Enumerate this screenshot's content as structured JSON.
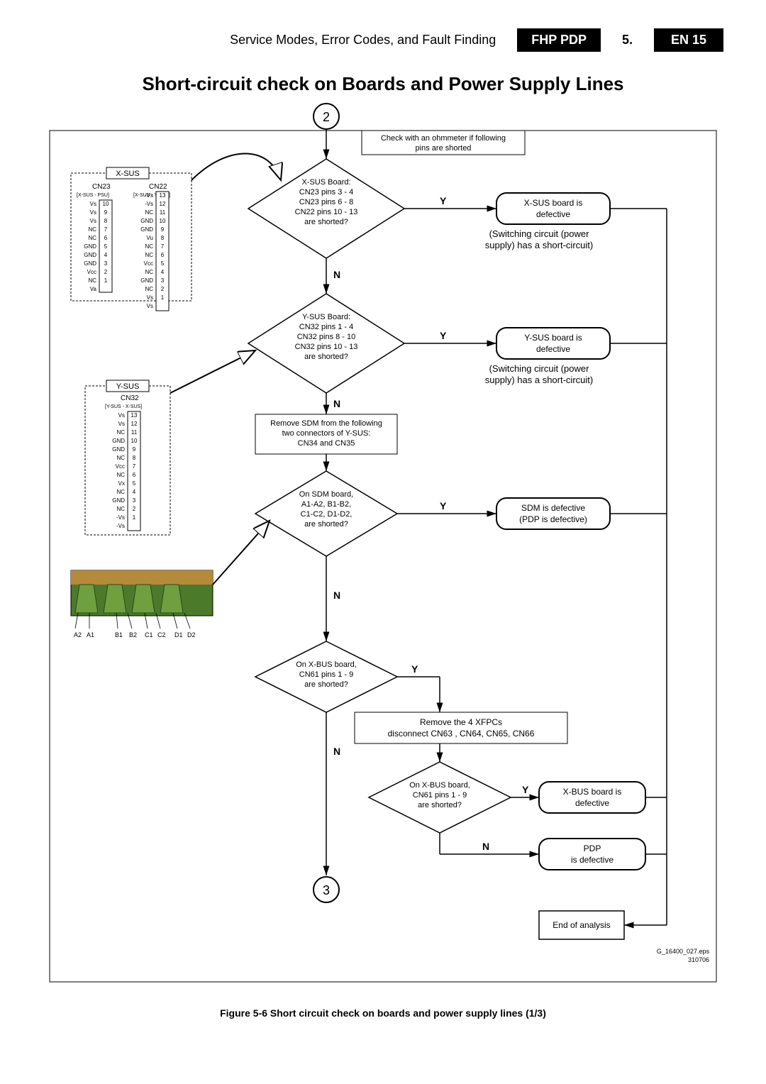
{
  "header": {
    "crumb": "Service Modes, Error Codes, and Fault Finding",
    "model": "FHP PDP",
    "section": "5.",
    "page": "EN 15"
  },
  "title": "Short-circuit check on Boards and Power Supply Lines",
  "chart_data": {
    "type": "flowchart",
    "start_ref": "2",
    "end_ref": "3",
    "note": "Check with an ohmmeter if following pins are shorted",
    "nodes": [
      {
        "id": "d1",
        "type": "decision",
        "lines": [
          "X-SUS Board:",
          "CN23 pins 3 - 4",
          "CN23 pins 6 - 8",
          "CN22 pins 10 - 13",
          "are shorted?"
        ]
      },
      {
        "id": "r1",
        "type": "result",
        "lines": [
          "X-SUS board is",
          "defective"
        ],
        "caption": "(Switching circuit (power supply) has a short-circuit)"
      },
      {
        "id": "d2",
        "type": "decision",
        "lines": [
          "Y-SUS Board:",
          "CN32 pins 1 - 4",
          "CN32 pins 8 - 10",
          "CN32 pins 10 - 13",
          "are shorted?"
        ]
      },
      {
        "id": "r2",
        "type": "result",
        "lines": [
          "Y-SUS board is",
          "defective"
        ],
        "caption": "(Switching circuit (power supply) has a short-circuit)"
      },
      {
        "id": "p1",
        "type": "process",
        "lines": [
          "Remove SDM from the following",
          "two connectors of Y-SUS:",
          "CN34 and CN35"
        ]
      },
      {
        "id": "d3",
        "type": "decision",
        "lines": [
          "On SDM board,",
          "A1-A2, B1-B2,",
          "C1-C2, D1-D2,",
          "are shorted?"
        ]
      },
      {
        "id": "r3",
        "type": "result",
        "lines": [
          "SDM is defective",
          "(PDP is defective)"
        ]
      },
      {
        "id": "d4",
        "type": "decision",
        "lines": [
          "On X-BUS board,",
          "CN61 pins 1 - 9",
          "are shorted?"
        ]
      },
      {
        "id": "p2",
        "type": "process",
        "lines": [
          "Remove the 4 XFPCs",
          "disconnect CN63 , CN64, CN65, CN66"
        ]
      },
      {
        "id": "d5",
        "type": "decision",
        "lines": [
          "On X-BUS board,",
          "CN61 pins 1 - 9",
          "are shorted?"
        ]
      },
      {
        "id": "r5y",
        "type": "result",
        "lines": [
          "X-BUS board is",
          "defective"
        ]
      },
      {
        "id": "r5n",
        "type": "result",
        "lines": [
          "PDP",
          "is defective"
        ]
      },
      {
        "id": "end",
        "type": "terminal",
        "lines": [
          "End of analysis"
        ]
      }
    ],
    "connectors": {
      "xsus": {
        "title": "X-SUS",
        "cn23": {
          "label": "CN23",
          "sub": "[X-SUS - PSU]",
          "pins": [
            [
              "10",
              "Vs"
            ],
            [
              "9",
              "Vs"
            ],
            [
              "8",
              "Vs"
            ],
            [
              "7",
              "NC"
            ],
            [
              "6",
              "NC"
            ],
            [
              "5",
              "GND"
            ],
            [
              "4",
              "GND"
            ],
            [
              "3",
              "GND"
            ],
            [
              "2",
              "Vcc"
            ],
            [
              "1",
              "NC"
            ],
            [
              "",
              "Va"
            ]
          ]
        },
        "cn22": {
          "label": "CN22",
          "sub": "[X-SUS - Y-SUS]",
          "pins": [
            [
              "13",
              "-Vs"
            ],
            [
              "12",
              "-Vs"
            ],
            [
              "11",
              "NC"
            ],
            [
              "10",
              "GND"
            ],
            [
              "9",
              "GND"
            ],
            [
              "8",
              "Vu"
            ],
            [
              "7",
              "NC"
            ],
            [
              "6",
              "NC"
            ],
            [
              "5",
              "Vcc"
            ],
            [
              "4",
              "NC"
            ],
            [
              "3",
              "GND"
            ],
            [
              "2",
              "NC"
            ],
            [
              "1",
              "Vs"
            ],
            [
              "",
              "Vs"
            ]
          ]
        }
      },
      "ysus": {
        "title": "Y-SUS",
        "cn32": {
          "label": "CN32",
          "sub": "[Y-SUS - X-SUS]",
          "pins": [
            [
              "13",
              "Vs"
            ],
            [
              "12",
              "Vs"
            ],
            [
              "11",
              "NC"
            ],
            [
              "10",
              "GND"
            ],
            [
              "9",
              "GND"
            ],
            [
              "8",
              "NC"
            ],
            [
              "7",
              "Vcc"
            ],
            [
              "6",
              "NC"
            ],
            [
              "5",
              "Vx"
            ],
            [
              "4",
              "NC"
            ],
            [
              "3",
              "GND"
            ],
            [
              "2",
              "NC"
            ],
            [
              "1",
              "-Vs"
            ],
            [
              "",
              "-Vs"
            ]
          ]
        }
      }
    },
    "sdm_lines": [
      "A2",
      "A1",
      "B1",
      "B2",
      "C1",
      "C2",
      "D1",
      "D2"
    ]
  },
  "caption": "Figure 5-6 Short circuit check on boards and power supply lines (1/3)",
  "footer": {
    "file": "G_16400_027.eps",
    "date": "310706"
  }
}
